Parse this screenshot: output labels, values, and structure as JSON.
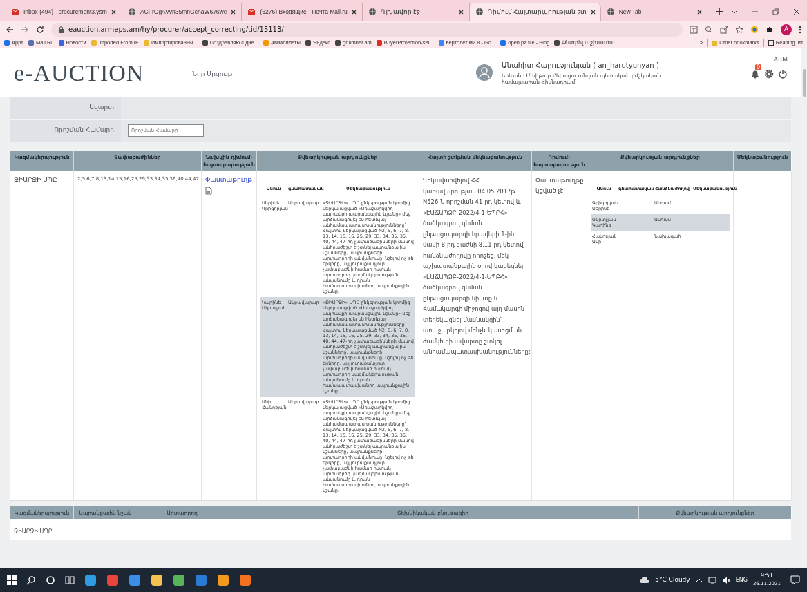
{
  "browser": {
    "tabs": [
      {
        "label": "Inbox (494) - procurement3.ysm",
        "selected": false
      },
      {
        "label": "ACFrOgAVvn35mnGcnaW676we",
        "selected": false
      },
      {
        "label": "(6276) Входящие - Почта Mail.ru",
        "selected": false
      },
      {
        "label": "Գլխավոր էջ",
        "selected": false
      },
      {
        "label": "Դիմում-Հայտարարության շտ",
        "selected": true
      },
      {
        "label": "New Tab",
        "selected": false
      }
    ],
    "new_tab": "+",
    "url": "eauction.armeps.am/hy/procurer/accept_correcting/tid/15113/",
    "profile_initial": "A",
    "bookmarks": [
      "Apps",
      "Mail.Ru",
      "Новости",
      "Imported From IE",
      "Импортированны...",
      "Поздравляю с дне...",
      "Авиабилеты",
      "Яндекс",
      "gnumner.am",
      "BuyerProtection-sel...",
      "вертолет ми 8 - Go...",
      "open pz file - Bing",
      "Փնտրել աշխատա..."
    ],
    "more_bookmarks": "»",
    "other_bookmarks": "Other bookmarks",
    "reading_list": "Reading list"
  },
  "header": {
    "logo": "e-AUCTION",
    "nav_link": "Նոր Մրցույթ",
    "user": "Անահիտ Հարությունյան ( an_harutyunyan )",
    "organization": "Երևանի Մխիթար Հերացու անվան պետական բժշկական համալսարան Հիմնադրամ",
    "language": "ARM",
    "notification_badge": "0"
  },
  "filters": [
    {
      "label": "Ավարտ",
      "kind": "text"
    },
    {
      "label": "Որոշման Համարը",
      "kind": "input",
      "placeholder": "Որոշման Համարը"
    }
  ],
  "table": {
    "columns": [
      "Կազմակերպություն",
      "Չափաբաժիններ",
      "Նախկին դիմում-հայտարարություն",
      "Քվեարկության արդյունքներ",
      "Հայտի շտկման մեկնաբանություն",
      "Դիմում-հայտարարություն",
      "Քվեարկության արդյունքներ",
      "Մեկնաբանություն"
    ],
    "rows": [
      {
        "organization": "ՋԻԱՐՋԻ ՍՊԸ",
        "lots": "2,5,6,7,8,13,14,15,16,25,29,33,34,35,36,40,44,47",
        "previous_document": "Փաստաթուղթ",
        "votes": {
          "columns": [
            "Անուն",
            "գնահատական",
            "Մեկնաբանություն"
          ],
          "rows": [
            [
              "Սերինե Գրիգորյան",
              "Անբավարար",
              "«ՋԻԱՐՋԻ» ՍՊԸ ընկերության կողմից ներկայացված «Առաջարկվող ապրանքի ապրանքային նշանը» մեջ արձանագրվել են հետևյալ անհամապատասխանությունները՝ Հայտով ներկայացված N2, 5, 6, 7, 8, 13, 14, 15, 16, 25, 29, 33, 34, 35, 36, 40, 44, 47-րդ չափաբաժինների մասով անհրաժեշտ է շտկել ապրանքային նշանները, ապրանքների արտադրողի անվանումը, նշելով ոչ թե երկիրը, այլ յուրաքանչյուր չափաբաժնի համար հստակ արտադրող կազմակերպության անվանումը և դրան համապատասխանող ապրանքային նշանը:"
            ],
            [
              "Կարինե Մկրտչյան",
              "Անբավարար",
              "«ՋԻԱՐՋԻ» ՍՊԸ ընկերության կողմից ներկայացված «Առաջարկվող ապրանքի ապրանքային նշանը» մեջ արձանագրվել են հետևյալ անհամապատասխանությունները՝ Հայտով ներկայացված N2, 5, 6, 7, 8, 13, 14, 15, 16, 25, 29, 33, 34, 35, 36, 40, 44, 47-րդ չափաբաժինների մասով անհրաժեշտ է շտկել ապրանքային նշանները, ապրանքների արտադրողի անվանումը, նշելով ոչ թե երկիրը, այլ յուրաքանչյուր չափաբաժնի համար հստակ արտադրող կազմակերպության անվանումը և դրան համապատասխանող ապրանքային նշանը:"
            ],
            [
              "Անի Հակոբյան",
              "Անբավարար",
              "«ՋԻԱՐՋԻ» ՍՊԸ ընկերության կողմից ներկայացված «Առաջարկվող ապրանքի ապրանքային նշանը» մեջ արձանագրվել են հետևյալ անհամապատասխանությունները՝ Հայտով ներկայացված N2, 5, 6, 7, 8, 13, 14, 15, 16, 25, 29, 33, 34, 35, 36, 40, 44, 47-րդ չափաբաժինների մասով անհրաժեշտ է շտկել ապրանքային նշանները, ապրանքների արտադրողի անվանումը, նշելով ոչ թե երկիրը, այլ յուրաքանչյուր չափաբաժնի համար հստակ արտադրող կազմակերպության անվանումը և դրան համապատասխանող ապրանքային նշանը:"
            ]
          ]
        },
        "correction_comment": "Ղեկավարվելով ՀՀ կառավարության 04.05.2017թ. N526-Ն որոշման 41-րդ կետով և «ԷԱՃԱՊՁԲ-2022/4-1-ԵՊԲՀ» ծածկագրով գնման ընթացակարգի հրավերի 1-ին մասի 8-րդ բաժնի 8.11-րդ կետով՝ հանձնաժողովը որոշեց. մեկ աշխատանքային օրով կասեցնել «ԷԱՃԱՊՁԲ-2022/4-1-ԵՊԲՀ» ծածկագրով գնման ընթացակարգի նիստը և Համակարգի միջոցով այդ մասին տեղեկացնել մասնակցին՝ առաջարկելով մինչև կասեցման ժամկետի ավարտը շտկել անհամապատասխանությունները:",
        "document_status": "Փաստաթուղթը կցված չէ",
        "votes_2": {
          "columns": [
            "Անուն",
            "գնահատական",
            "Հանձնաժողով",
            "Մեկնաբանություն"
          ],
          "rows": [
            [
              "Գրիգորյան Սերինե",
              "",
              "Անդամ",
              ""
            ],
            [
              "Մկրտչյան Կարինե",
              "",
              "Անդամ",
              ""
            ],
            [
              "Հակոբյան Անի",
              "",
              "Նախագահ",
              ""
            ]
          ]
        }
      }
    ]
  },
  "table_2": {
    "columns": [
      "Կազմակերպություն",
      "Ապրանքային նշան",
      "Արտադրող",
      "Տեխնիկական բնութագիր",
      "Քվեարկության արդյունքներ"
    ],
    "rows": [
      {
        "organization": "ՋԻԱՐՋԻ ՍՊԸ"
      }
    ]
  },
  "taskbar": {
    "weather": "5°C Cloudy",
    "language": "ENG",
    "time": "9:51",
    "date": "26.11.2021"
  }
}
